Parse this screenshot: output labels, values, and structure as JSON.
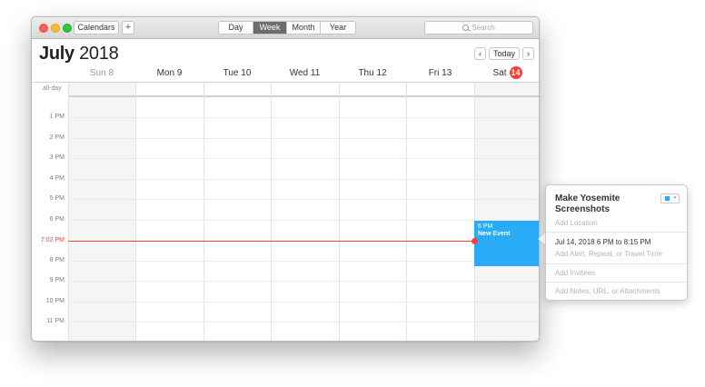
{
  "toolbar": {
    "calendars_label": "Calendars",
    "add_label": "+",
    "views": [
      "Day",
      "Week",
      "Month",
      "Year"
    ],
    "active_view": "Week",
    "search_placeholder": "Search"
  },
  "header": {
    "month": "July",
    "year": "2018",
    "today_label": "Today",
    "prev_label": "‹",
    "next_label": "›"
  },
  "days": [
    {
      "name": "Sun",
      "num": "8"
    },
    {
      "name": "Mon",
      "num": "9"
    },
    {
      "name": "Tue",
      "num": "10"
    },
    {
      "name": "Wed",
      "num": "11"
    },
    {
      "name": "Thu",
      "num": "12"
    },
    {
      "name": "Fri",
      "num": "13"
    },
    {
      "name": "Sat",
      "num": "14"
    }
  ],
  "allday_label": "all-day",
  "hours": [
    "1 PM",
    "2 PM",
    "3 PM",
    "4 PM",
    "5 PM",
    "6 PM",
    "",
    "8 PM",
    "9 PM",
    "10 PM",
    "11 PM"
  ],
  "now_label": "7:02 PM",
  "event": {
    "time": "6 PM",
    "title": "New Event",
    "color": "#2aabf8"
  },
  "popover": {
    "title": "Make Yosemite Screenshots",
    "location_placeholder": "Add Location",
    "date_text": "Jul 14, 2018  6 PM to 8:15 PM",
    "alert_placeholder": "Add Alert, Repeat, or Travel Time",
    "invitees_placeholder": "Add Invitees",
    "notes_placeholder": "Add Notes, URL, or Attachments"
  },
  "colors": {
    "accent": "#fc3d39",
    "event_blue": "#2aabf8",
    "active_segment": "#6d6d6d"
  }
}
